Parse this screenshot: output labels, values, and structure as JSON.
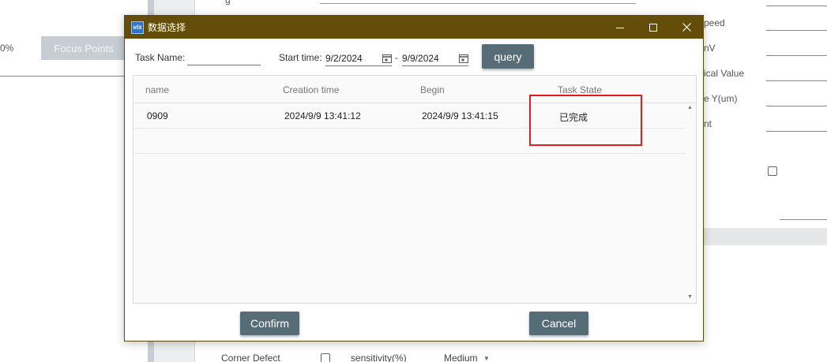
{
  "background": {
    "percent_text": "0%",
    "focus_button": "Focus Points",
    "right_labels": [
      "peed",
      "nV",
      "ical Value",
      "e Y(um)",
      "nt"
    ],
    "bottom_row": {
      "label": "Corner Defect",
      "sensitivity_label": "sensitivity(%)",
      "sensitivity_value": "Medium"
    }
  },
  "dialog": {
    "title": "数据选择",
    "app_icon_text": "vis",
    "filters": {
      "task_name_label": "Task Name:",
      "task_name_value": "",
      "start_time_label": "Start time:",
      "start_date": "9/2/2024",
      "date_separator": "-",
      "end_date": "9/9/2024",
      "query_label": "query"
    },
    "table": {
      "columns": [
        "name",
        "Creation time",
        "Begin",
        "Task State"
      ],
      "rows": [
        [
          "0909",
          "2024/9/9 13:41:12",
          "2024/9/9 13:41:15",
          "已完成"
        ]
      ]
    },
    "confirm_label": "Confirm",
    "cancel_label": "Cancel"
  },
  "colors": {
    "titlebar": "#634d09",
    "button": "#566d77",
    "highlight": "#e01d1d"
  }
}
